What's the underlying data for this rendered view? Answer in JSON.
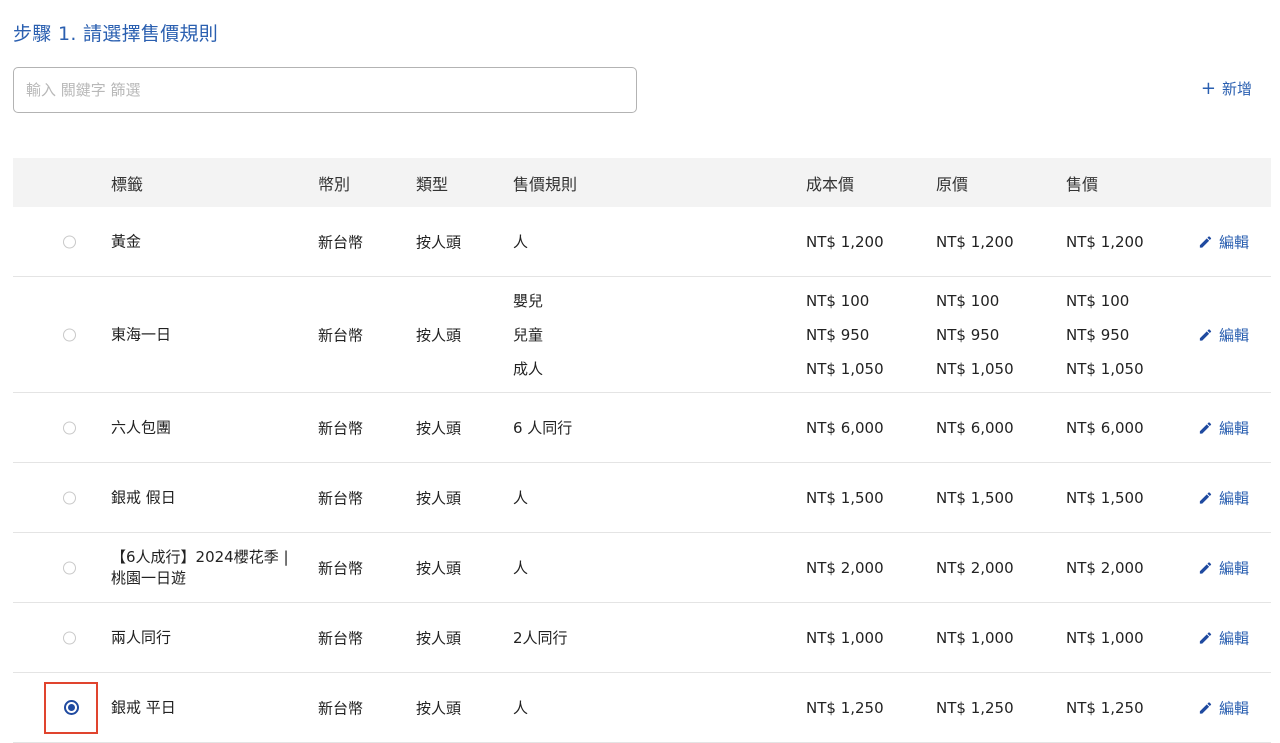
{
  "step_title": "步驟 1. 請選擇售價規則",
  "filter": {
    "placeholder": "輸入 關鍵字 篩選",
    "value": ""
  },
  "add_button": {
    "icon": "+",
    "label": "新增"
  },
  "table": {
    "headers": {
      "label": "標籤",
      "currency": "幣別",
      "type": "類型",
      "rule": "售價規則",
      "cost": "成本價",
      "original": "原價",
      "sale": "售價"
    },
    "edit_label": "編輯",
    "rows": [
      {
        "label": "黃金",
        "currency": "新台幣",
        "type": "按人頭",
        "rules": [
          "人"
        ],
        "cost": [
          "NT$ 1,200"
        ],
        "original": [
          "NT$ 1,200"
        ],
        "sale": [
          "NT$ 1,200"
        ],
        "selected": false
      },
      {
        "label": "東海一日",
        "currency": "新台幣",
        "type": "按人頭",
        "rules": [
          "嬰兒",
          "兒童",
          "成人"
        ],
        "cost": [
          "NT$ 100",
          "NT$ 950",
          "NT$ 1,050"
        ],
        "original": [
          "NT$ 100",
          "NT$ 950",
          "NT$ 1,050"
        ],
        "sale": [
          "NT$ 100",
          "NT$ 950",
          "NT$ 1,050"
        ],
        "selected": false
      },
      {
        "label": "六人包團",
        "currency": "新台幣",
        "type": "按人頭",
        "rules": [
          "6 人同行"
        ],
        "cost": [
          "NT$ 6,000"
        ],
        "original": [
          "NT$ 6,000"
        ],
        "sale": [
          "NT$ 6,000"
        ],
        "selected": false
      },
      {
        "label": "銀戒 假日",
        "currency": "新台幣",
        "type": "按人頭",
        "rules": [
          "人"
        ],
        "cost": [
          "NT$ 1,500"
        ],
        "original": [
          "NT$ 1,500"
        ],
        "sale": [
          "NT$ 1,500"
        ],
        "selected": false
      },
      {
        "label": "【6人成行】2024櫻花季 | 桃園一日遊",
        "currency": "新台幣",
        "type": "按人頭",
        "rules": [
          "人"
        ],
        "cost": [
          "NT$ 2,000"
        ],
        "original": [
          "NT$ 2,000"
        ],
        "sale": [
          "NT$ 2,000"
        ],
        "selected": false
      },
      {
        "label": "兩人同行",
        "currency": "新台幣",
        "type": "按人頭",
        "rules": [
          "2人同行"
        ],
        "cost": [
          "NT$ 1,000"
        ],
        "original": [
          "NT$ 1,000"
        ],
        "sale": [
          "NT$ 1,000"
        ],
        "selected": false
      },
      {
        "label": "銀戒 平日",
        "currency": "新台幣",
        "type": "按人頭",
        "rules": [
          "人"
        ],
        "cost": [
          "NT$ 1,250"
        ],
        "original": [
          "NT$ 1,250"
        ],
        "sale": [
          "NT$ 1,250"
        ],
        "selected": true
      }
    ]
  },
  "colors": {
    "accent": "#2a5fb0",
    "highlight_border": "#e0442e",
    "header_bg": "#f3f3f3"
  }
}
